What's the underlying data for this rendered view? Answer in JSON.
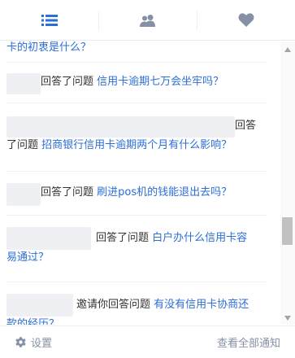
{
  "tabs": [
    {
      "icon": "list-icon",
      "active": true
    },
    {
      "icon": "users-icon",
      "active": false
    },
    {
      "icon": "heart-icon",
      "active": false
    }
  ],
  "notifications": {
    "top_partial": "卡的初衷是什么？",
    "items": [
      {
        "action": "回答了问题",
        "question": "信用卡逾期七万会坐牢吗？"
      },
      {
        "action_line1": "回答",
        "action_line2": "了问题",
        "question": "招商银行信用卡逾期两个月有什么影响？"
      },
      {
        "action": "回答了问题",
        "question": "刷进pos机的钱能退出去吗？"
      },
      {
        "action": "回答了问题",
        "question_line1": "白户办什么信用卡容",
        "question_line2": "易通过？"
      },
      {
        "action": "邀请你回答问题",
        "question_line1": "有没有信用卡协商还",
        "question_line2": "款的经历？"
      }
    ]
  },
  "footer": {
    "settings_label": "设置",
    "view_all_label": "查看全部通知"
  },
  "colors": {
    "accent": "#2b6ed6",
    "icon_inactive": "#8590a6",
    "placeholder": "#eef0f4"
  }
}
